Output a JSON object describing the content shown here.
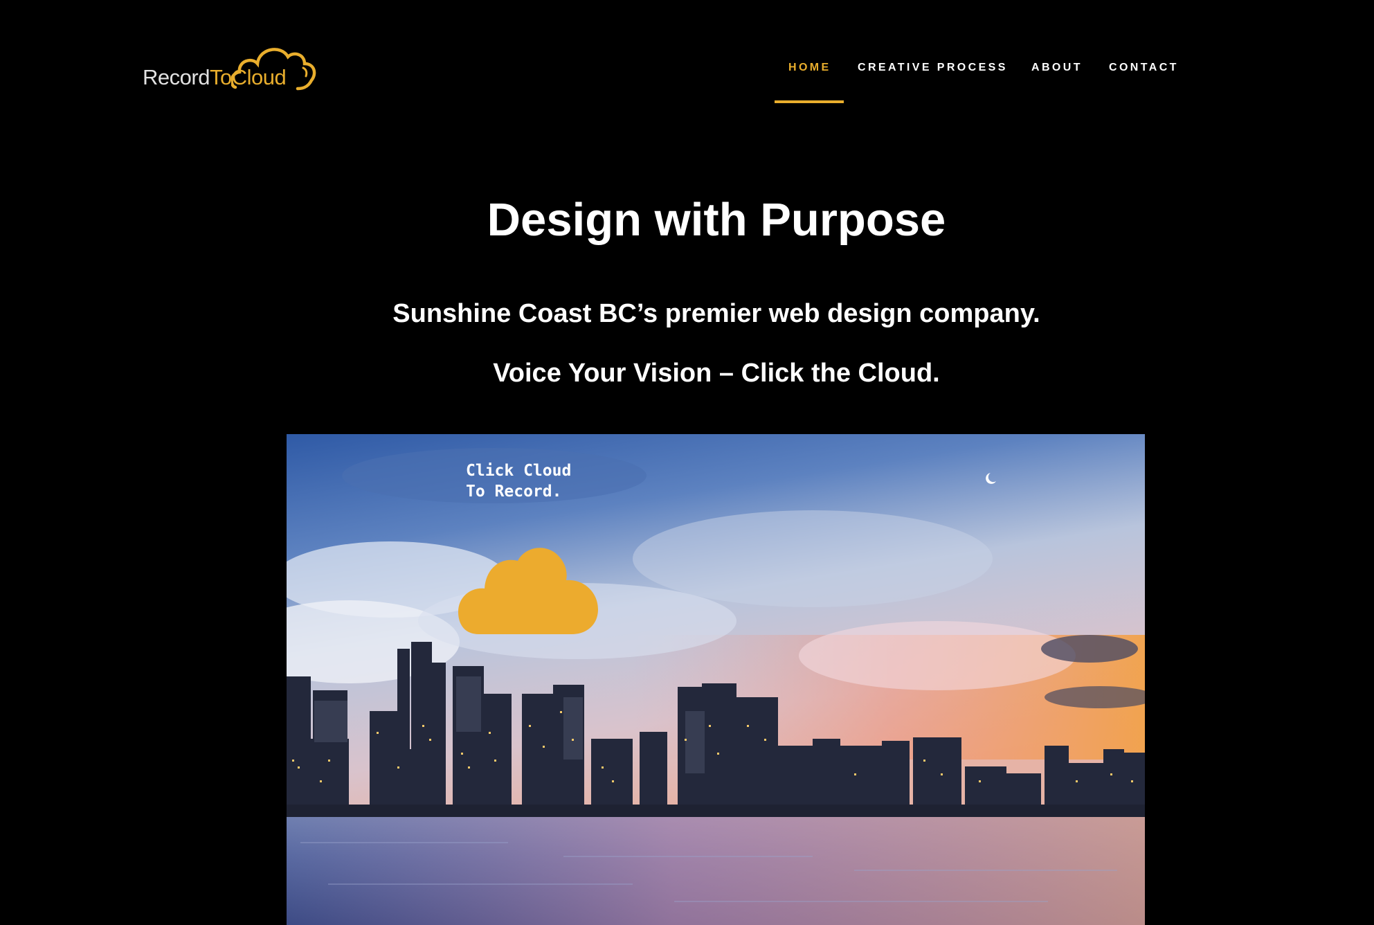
{
  "brand": {
    "logo_text_part1": "Record",
    "logo_text_part2": "To",
    "logo_text_part3": "Cloud",
    "accent_color": "#e9ae2d"
  },
  "nav": {
    "items": [
      {
        "label": "HOME",
        "active": true
      },
      {
        "label": "CREATIVE PROCESS",
        "active": false
      },
      {
        "label": "ABOUT",
        "active": false
      },
      {
        "label": "CONTACT",
        "active": false
      }
    ]
  },
  "hero": {
    "title": "Design with Purpose",
    "subtitle": "Sunshine Coast BC’s premier web design company.",
    "cta_text": "Voice Your Vision – Click the Cloud."
  },
  "record_widget": {
    "hint": "Click Cloud\nTo Record.",
    "icon": "cloud-icon",
    "cloud_color": "#ecab2e"
  }
}
